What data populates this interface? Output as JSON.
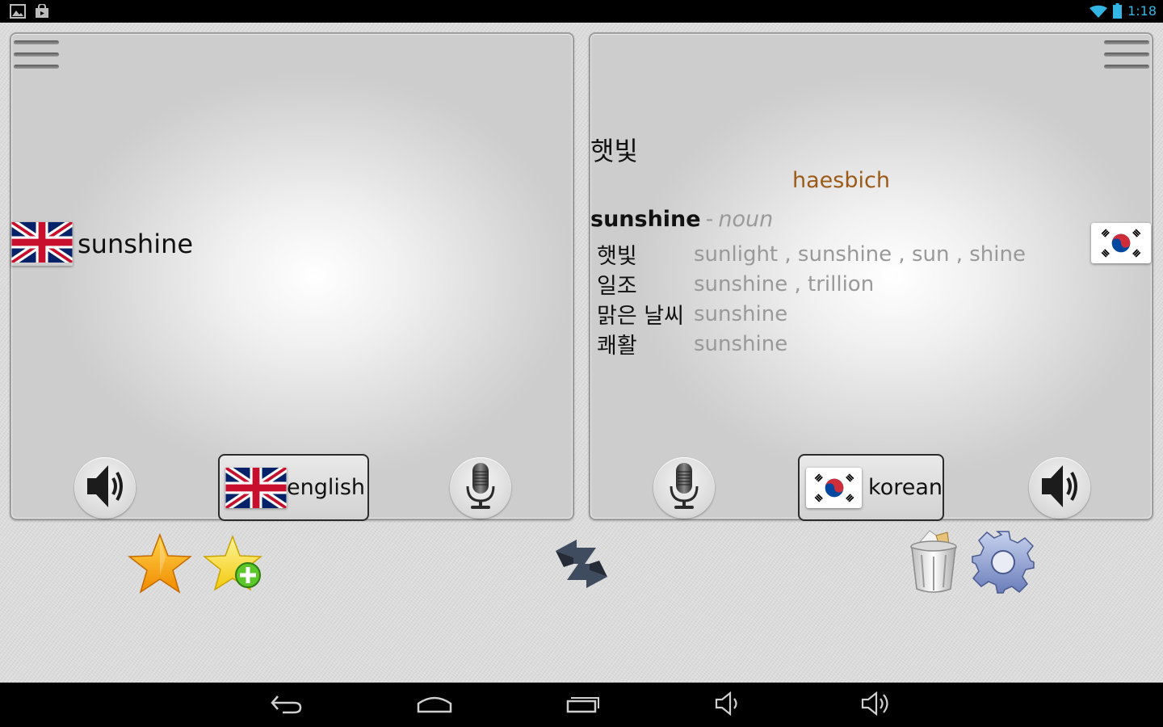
{
  "status_bar": {
    "time": "1:18",
    "icons": [
      "gallery-icon",
      "store-bag-icon",
      "wifi-icon",
      "battery-icon"
    ]
  },
  "left_panel": {
    "source_text": "sunshine",
    "source_flag": "uk-flag-icon",
    "language_button": {
      "label": "english"
    },
    "speaker": "speaker-icon",
    "microphone": "microphone-icon"
  },
  "right_panel": {
    "translation": "햇빛",
    "transliteration": "haesbich",
    "word": "sunshine",
    "separator": "-",
    "part_of_speech": "noun",
    "definitions": [
      {
        "korean": "햇빛",
        "english": "sunlight , sunshine , sun , shine"
      },
      {
        "korean": "일조",
        "english": "sunshine , trillion"
      },
      {
        "korean": "맑은 날씨",
        "english": "sunshine"
      },
      {
        "korean": "쾌활",
        "english": "sunshine"
      }
    ],
    "target_flag": "korea-flag-icon",
    "language_button": {
      "label": "korean"
    },
    "speaker": "speaker-icon",
    "microphone": "microphone-icon"
  },
  "toolbar": {
    "items": [
      "favorites-star-icon",
      "add-favorite-icon",
      "swap-languages-icon",
      "trash-icon",
      "settings-gear-icon"
    ]
  },
  "nav_bar": {
    "items": [
      "back-icon",
      "home-icon",
      "recent-apps-icon",
      "volume-down-icon",
      "volume-up-icon"
    ]
  },
  "colors": {
    "transliteration": "#9c5a18",
    "muted_text": "#999999",
    "status_accent": "#33b5e5"
  }
}
